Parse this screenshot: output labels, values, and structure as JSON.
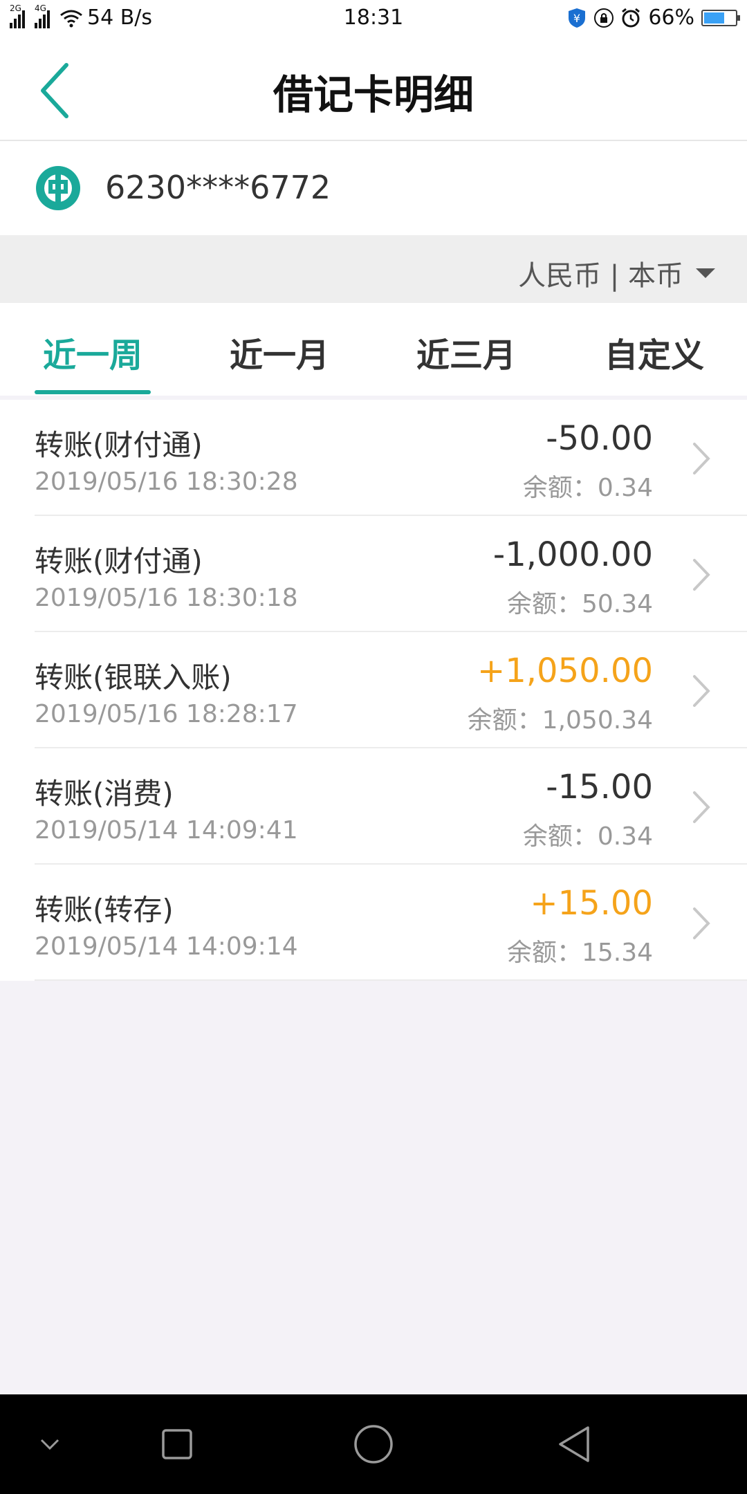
{
  "status_bar": {
    "signal_tag_1": "2G",
    "signal_tag_2": "4G",
    "net_speed": "54 B/s",
    "time": "18:31",
    "battery": "66%",
    "battery_level": 0.66
  },
  "header": {
    "title": "借记卡明细"
  },
  "account": {
    "card_number": "6230****6772"
  },
  "currency": {
    "label": "人民币 | 本币"
  },
  "tabs": [
    {
      "label": "近一周",
      "active": true
    },
    {
      "label": "近一月",
      "active": false
    },
    {
      "label": "近三月",
      "active": false
    },
    {
      "label": "自定义",
      "active": false
    }
  ],
  "transactions": [
    {
      "title": "转账(财付通)",
      "datetime": "2019/05/16 18:30:28",
      "amount": "-50.00",
      "balance": "余额：0.34",
      "type": "expense"
    },
    {
      "title": "转账(财付通)",
      "datetime": "2019/05/16 18:30:18",
      "amount": "-1,000.00",
      "balance": "余额：50.34",
      "type": "expense"
    },
    {
      "title": "转账(银联入账)",
      "datetime": "2019/05/16 18:28:17",
      "amount": "+1,050.00",
      "balance": "余额：1,050.34",
      "type": "income"
    },
    {
      "title": "转账(消费)",
      "datetime": "2019/05/14 14:09:41",
      "amount": "-15.00",
      "balance": "余额：0.34",
      "type": "expense"
    },
    {
      "title": "转账(转存)",
      "datetime": "2019/05/14 14:09:14",
      "amount": "+15.00",
      "balance": "余额：15.34",
      "type": "income"
    }
  ],
  "colors": {
    "accent": "#1aa99a",
    "income": "#f5a31a",
    "expense": "#333333"
  },
  "icons": {
    "back": "back-arrow-icon",
    "bank_logo": "abc-bank-logo-icon",
    "dropdown": "caret-down-icon",
    "row_arrow": "chevron-right-icon",
    "nav_down": "chevron-down-icon",
    "nav_recents": "square-icon",
    "nav_home": "circle-icon",
    "nav_back": "triangle-back-icon"
  }
}
